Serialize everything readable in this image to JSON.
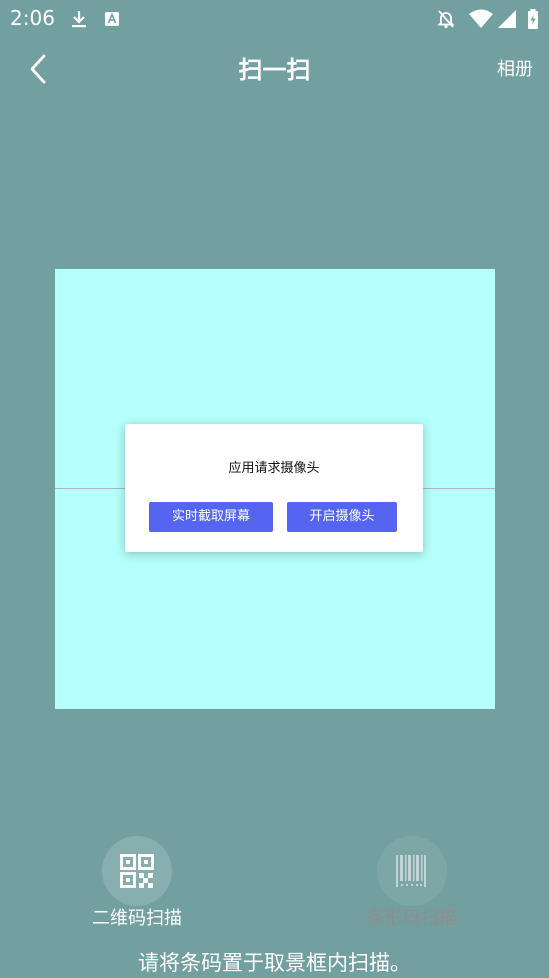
{
  "status_bar": {
    "time": "2:06",
    "icons": [
      "download-icon",
      "a-notification-icon",
      "bell-off-icon",
      "wifi-icon",
      "signal-icon",
      "battery-charging-icon"
    ]
  },
  "header": {
    "title": "扫一扫",
    "album_label": "相册",
    "back_icon": "chevron-left-icon"
  },
  "dialog": {
    "message": "应用请求摄像头",
    "button_left": "实时截取屏幕",
    "button_right": "开启摄像头",
    "button_color": "#5565f1"
  },
  "modes": [
    {
      "label": "二维码扫描",
      "icon": "qr-code-icon",
      "active": true
    },
    {
      "label": "条形码扫描",
      "icon": "barcode-icon",
      "active": false
    }
  ],
  "hint": "请将条码置于取景框内扫描。",
  "colors": {
    "background": "#72a0a0",
    "scan_area": "#b5fffc",
    "inactive_label": "#8e8e8e"
  }
}
